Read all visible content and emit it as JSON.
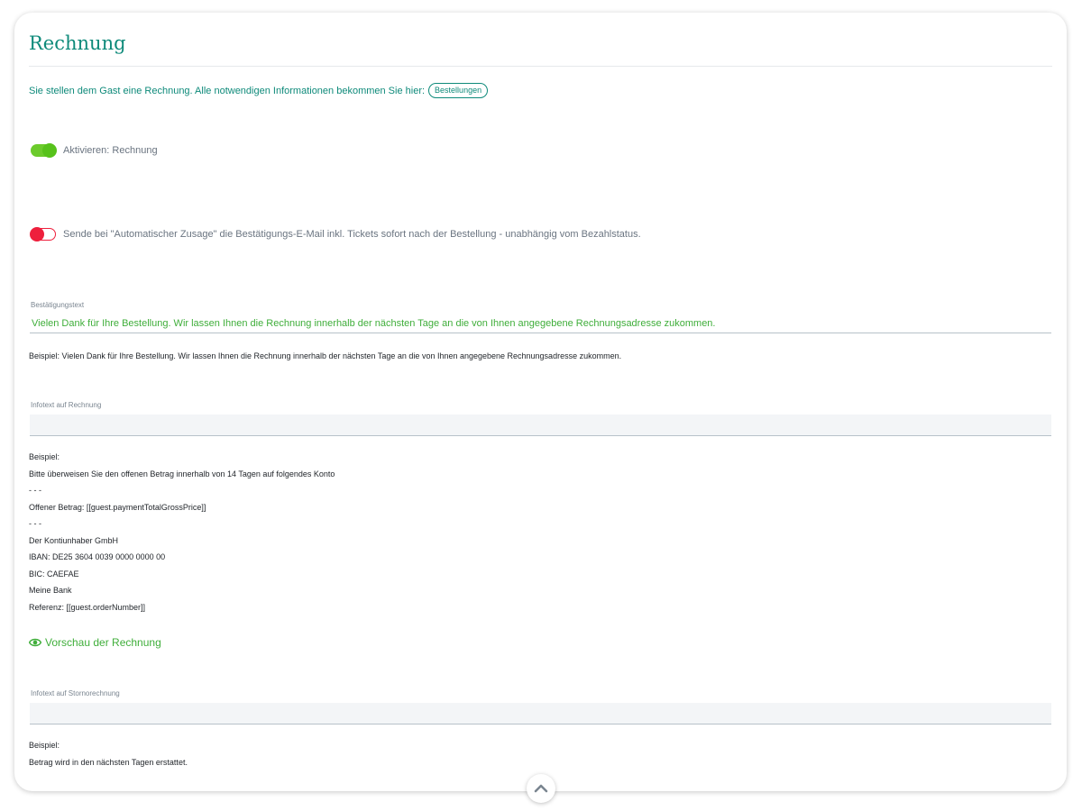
{
  "page": {
    "title": "Rechnung",
    "intro_text": "Sie stellen dem Gast eine Rechnung. Alle notwendigen Informationen bekommen Sie hier:",
    "orders_button": "Bestellungen"
  },
  "toggles": {
    "activate_invoice": {
      "label": "Aktivieren: Rechnung",
      "state": "on"
    },
    "auto_confirm": {
      "label": "Sende bei \"Automatischer Zusage\" die Bestätigungs-E-Mail inkl. Tickets sofort nach der Bestellung - unabhängig vom Bezahlstatus.",
      "state": "off"
    }
  },
  "confirmation_text": {
    "label": "Bestätigungstext",
    "value": "Vielen Dank für Ihre Bestellung. Wir lassen Ihnen die Rechnung innerhalb der nächsten Tage an die von Ihnen angegebene Rechnungsadresse zukommen.",
    "example": "Beispiel: Vielen Dank für Ihre Bestellung. Wir lassen Ihnen die Rechnung innerhalb der nächsten Tage an die von Ihnen angegebene Rechnungsadresse zukommen."
  },
  "invoice_info": {
    "label": "Infotext auf Rechnung",
    "value": "",
    "example_lines": [
      "Beispiel:",
      "Bitte überweisen Sie den offenen Betrag innerhalb von 14 Tagen auf folgendes Konto",
      "- - -",
      "Offener Betrag: [[guest.paymentTotalGrossPrice]]",
      "- - -",
      "Der Kontiunhaber GmbH",
      "IBAN: DE25 3604 0039 0000 0000 00",
      "BIC: CAEFAE",
      "Meine Bank",
      "Referenz: [[guest.orderNumber]]"
    ]
  },
  "preview_link": {
    "label": "Vorschau der Rechnung",
    "icon": "eye-icon"
  },
  "cancellation_info": {
    "label": "Infotext auf Stornorechnung",
    "value": "",
    "example_lines": [
      "Beispiel:",
      "Betrag wird in den nächsten Tagen erstattet."
    ]
  },
  "colors": {
    "accent_teal": "#0e8a7a",
    "accent_green": "#3fae3a",
    "toggle_on": "#6ccb2c",
    "toggle_off": "#ee1f3c"
  },
  "scroll_top_icon": "chevron-up-icon"
}
